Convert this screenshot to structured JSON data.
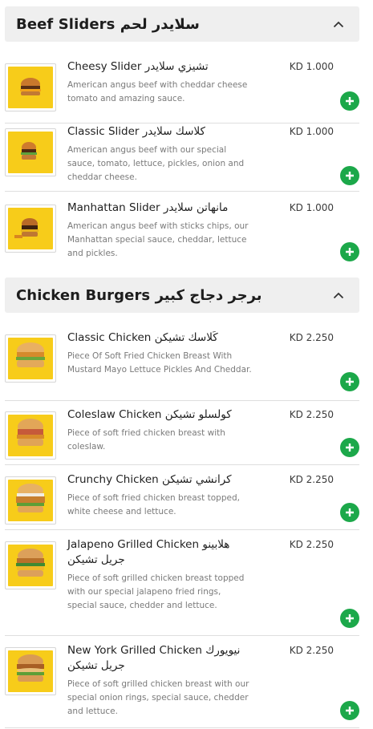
{
  "sections": [
    {
      "title": "Beef Sliders سلايدر لحم",
      "items": [
        {
          "name": "Cheesy Slider تشيزي سلايدر",
          "description": "American angus beef with cheddar cheese tomato and amazing sauce.",
          "price": "KD 1.000"
        },
        {
          "name": "Classic Slider كلاسك سلايدر",
          "description": "American angus beef with our special sauce, tomato, lettuce, pickles, onion and cheddar cheese.",
          "price": "KD 1.000"
        },
        {
          "name": "Manhattan Slider مانهاتن سلايدر",
          "description": "American angus beef with sticks chips, our Manhattan special sauce, cheddar, lettuce and pickles.",
          "price": "KD 1.000"
        }
      ]
    },
    {
      "title": "Chicken Burgers برجر دجاج كبير",
      "items": [
        {
          "name": "Classic Chicken كَلاسك تشيكن",
          "description": "Piece Of Soft Fried Chicken Breast With Mustard Mayo Lettuce Pickles And Cheddar.",
          "price": "KD 2.250"
        },
        {
          "name": "Coleslaw Chicken كولسلو تشيكن",
          "description": "Piece of soft fried chicken breast with coleslaw.",
          "price": "KD 2.250"
        },
        {
          "name": "Crunchy Chicken كرانشي تشيكن",
          "description": "Piece of soft fried chicken breast topped, white cheese and lettuce.",
          "price": "KD 2.250"
        },
        {
          "name": "Jalapeno Grilled Chicken هلابينو جريل تشيكن",
          "description": "Piece of soft grilled chicken breast topped with our special jalapeno fried rings, special sauce, chedder and lettuce.",
          "price": "KD 2.250"
        },
        {
          "name": "New York Grilled Chicken نيويورك جريل تشيكن",
          "description": "Piece of soft grilled chicken breast with our special onion rings, special sauce, chedder and lettuce.",
          "price": "KD 2.250"
        }
      ]
    }
  ],
  "colors": {
    "accent": "#1ca84a",
    "header_bg": "#efefef",
    "thumb_bg": "#f7cc1a"
  },
  "icons": {
    "collapse": "chevron-up-icon",
    "add": "plus-icon",
    "item_image": "burger-image"
  }
}
